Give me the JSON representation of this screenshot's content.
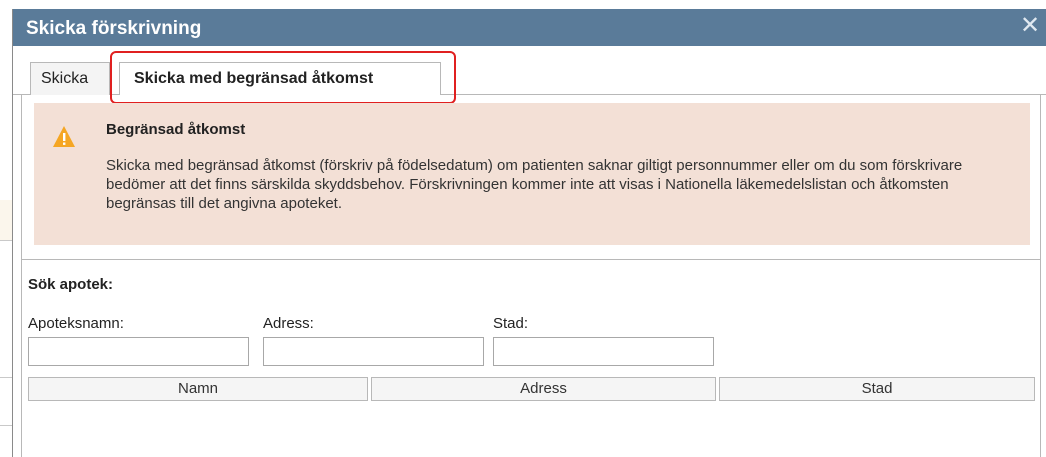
{
  "dialog": {
    "title": "Skicka förskrivning",
    "close_label": "✕"
  },
  "tabs": [
    {
      "label": "Skicka"
    },
    {
      "label": "Skicka med begränsad åtkomst",
      "selected": true
    }
  ],
  "warning": {
    "title": "Begränsad åtkomst",
    "text": "Skicka med begränsad åtkomst (förskriv på födelsedatum) om patienten saknar giltigt personnummer eller om du som förskrivare bedömer att det finns särskilda skyddsbehov. Förskrivningen kommer inte att visas i Nationella läkemedelslistan och åtkomsten begränsas till det angivna apoteket.",
    "icon": "warning-triangle-icon",
    "icon_color": "#f5a623",
    "background": "#f3e0d6"
  },
  "search": {
    "title": "Sök apotek:",
    "fields": [
      {
        "label": "Apoteksnamn:",
        "value": ""
      },
      {
        "label": "Adress:",
        "value": ""
      },
      {
        "label": "Stad:",
        "value": ""
      }
    ]
  },
  "table": {
    "columns": [
      "Namn",
      "Adress",
      "Stad"
    ],
    "rows": []
  },
  "colors": {
    "titlebar": "#5a7b99",
    "highlight": "#e02020"
  }
}
